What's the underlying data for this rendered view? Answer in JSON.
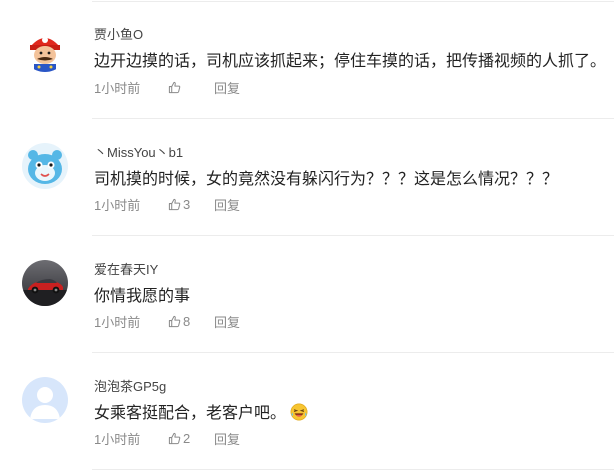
{
  "comments": [
    {
      "user": "贾小鱼O",
      "text": "边开边摸的话，司机应该抓起来；停住车摸的话，把传播视频的人抓了。",
      "time": "1小时前",
      "likes": "",
      "reply_label": "回复",
      "avatar_icon": "cartoon-plumber-avatar"
    },
    {
      "user": "丶MissYou丶b1",
      "text": "司机摸的时候，女的竟然没有躲闪行为？？？这是怎么情况？？？",
      "time": "1小时前",
      "likes": "3",
      "reply_label": "回复",
      "avatar_icon": "blue-creature-avatar"
    },
    {
      "user": "爱在春天IY",
      "text": "你情我愿的事",
      "time": "1小时前",
      "likes": "8",
      "reply_label": "回复",
      "avatar_icon": "red-car-avatar"
    },
    {
      "user": "泡泡茶GP5g",
      "text": "女乘客挺配合，老客户吧。",
      "time": "1小时前",
      "likes": "2",
      "reply_label": "回复",
      "avatar_icon": "default-user-avatar",
      "emoji_icon": "laughing-face-emoji"
    }
  ],
  "colors": {
    "meta_gray": "#8a8a8a",
    "separator": "#ececec",
    "default_avatar_bg": "#d7e6fb"
  }
}
